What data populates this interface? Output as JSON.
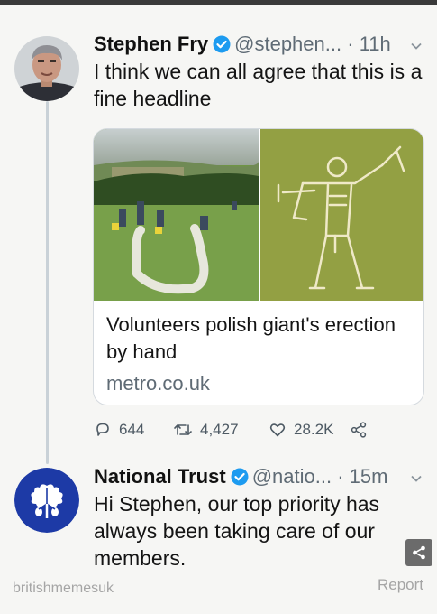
{
  "colors": {
    "verified": "#1d9bf0",
    "trust_blue": "#1d3aa6",
    "muted": "#5f6b75"
  },
  "tweets": [
    {
      "name": "Stephen Fry",
      "handle": "@stephen...",
      "dot": "·",
      "time": "11h",
      "text": "I think we can all agree that this is a fine headline",
      "avatar_icon": "portrait-photo",
      "card": {
        "title": "Volunteers polish giant's erection by hand",
        "domain": "metro.co.uk"
      },
      "stats": {
        "replies": "644",
        "retweets": "4,427",
        "likes": "28.2K"
      }
    },
    {
      "name": "National Trust",
      "handle": "@natio...",
      "dot": "·",
      "time": "15m",
      "text": "Hi Stephen, our top priority has always been taking care of our members.",
      "avatar_icon": "oak-leaf-logo"
    }
  ],
  "footer": {
    "watermark": "britishmemesuk",
    "report": "Report"
  }
}
